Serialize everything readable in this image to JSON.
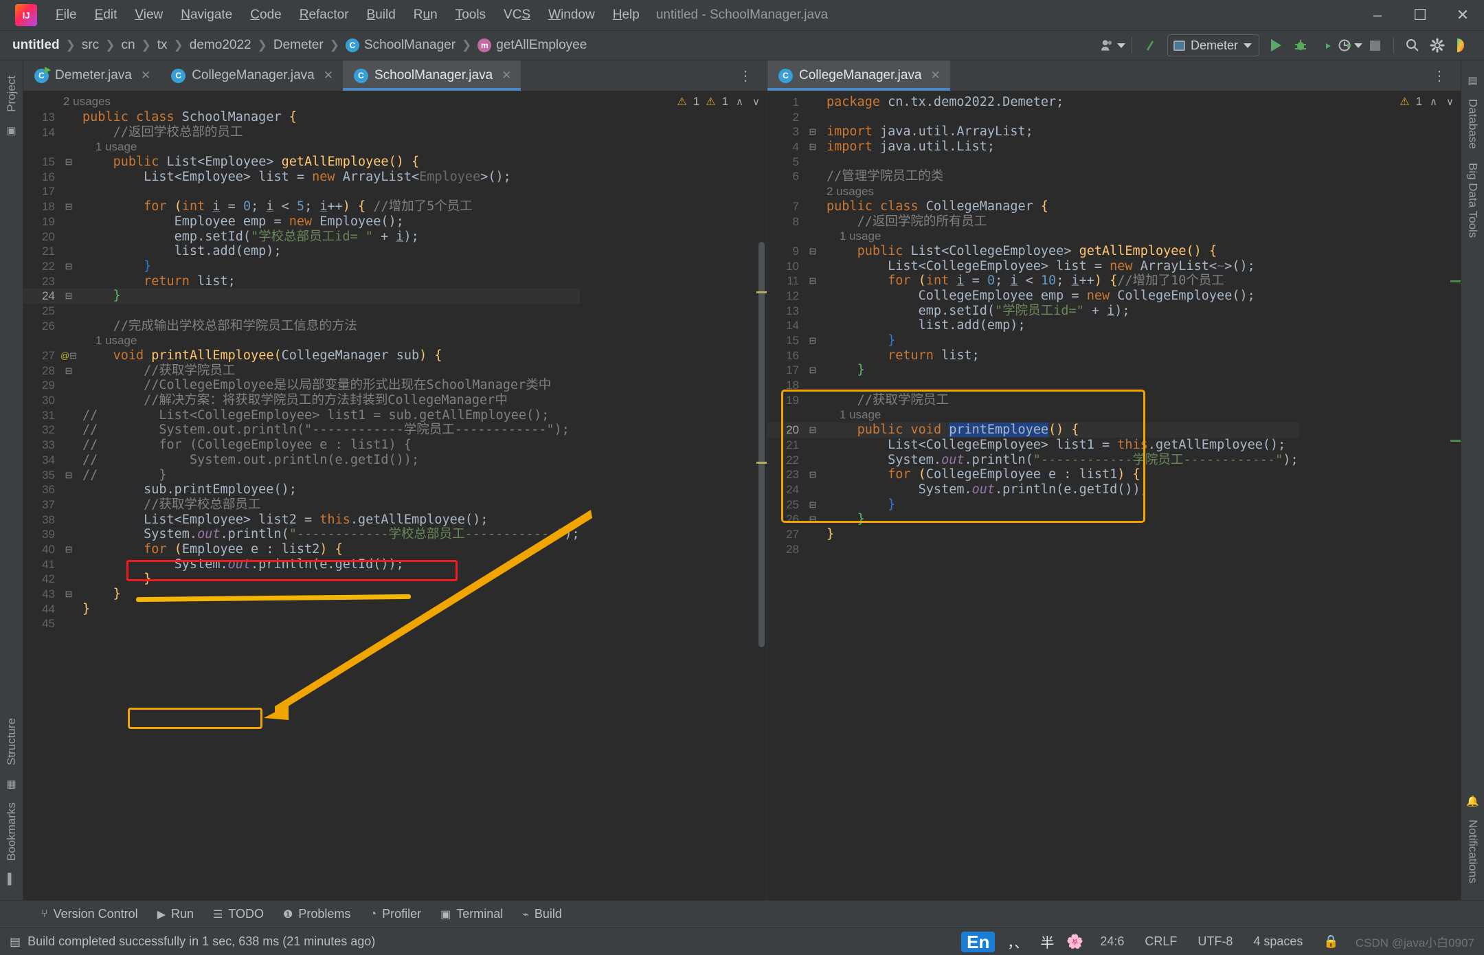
{
  "titlebar": {
    "logo": "intellij-idea-logo",
    "window_title": "untitled - SchoolManager.java",
    "menus": [
      {
        "pre": "",
        "mn": "F",
        "post": "ile"
      },
      {
        "pre": "",
        "mn": "E",
        "post": "dit"
      },
      {
        "pre": "",
        "mn": "V",
        "post": "iew"
      },
      {
        "pre": "",
        "mn": "N",
        "post": "avigate"
      },
      {
        "pre": "",
        "mn": "C",
        "post": "ode"
      },
      {
        "pre": "",
        "mn": "R",
        "post": "efactor"
      },
      {
        "pre": "",
        "mn": "B",
        "post": "uild"
      },
      {
        "pre": "R",
        "mn": "u",
        "post": "n"
      },
      {
        "pre": "",
        "mn": "T",
        "post": "ools"
      },
      {
        "pre": "VC",
        "mn": "S",
        "post": ""
      },
      {
        "pre": "",
        "mn": "W",
        "post": "indow"
      },
      {
        "pre": "",
        "mn": "H",
        "post": "elp"
      }
    ],
    "minimize": "–",
    "maximize": "☐",
    "close": "✕"
  },
  "navbar": {
    "crumbs": [
      {
        "label": "untitled",
        "icon": ""
      },
      {
        "label": "src",
        "icon": ""
      },
      {
        "label": "cn",
        "icon": ""
      },
      {
        "label": "tx",
        "icon": ""
      },
      {
        "label": "demo2022",
        "icon": ""
      },
      {
        "label": "Demeter",
        "icon": ""
      },
      {
        "label": "SchoolManager",
        "icon": "class-badge"
      },
      {
        "label": "getAllEmployee",
        "icon": "method-badge"
      }
    ],
    "separator": "❯",
    "class_badge_letter": "C",
    "method_badge_letter": "m",
    "run_config": "Demeter",
    "buttons": {
      "user": "user-icon",
      "updates": "update-project-icon",
      "run": "run-button",
      "debug": "debug-button",
      "coverage": "run-with-coverage-button",
      "profiler": "profiler-button",
      "stop": "stop-button",
      "search": "search-everywhere-button",
      "settings": "settings-button",
      "ai": "ai-assistant-button"
    }
  },
  "left_rail": {
    "project": "Project",
    "structure": "Structure",
    "bookmarks": "Bookmarks"
  },
  "right_rail": {
    "database": "Database",
    "bigdata": "Big Data Tools",
    "notifications": "Notifications"
  },
  "editor_left": {
    "tabs": [
      {
        "label": "Demeter.java",
        "active": false,
        "runnable": true
      },
      {
        "label": "CollegeManager.java",
        "active": false,
        "runnable": false
      },
      {
        "label": "SchoolManager.java",
        "active": true,
        "runnable": false
      }
    ],
    "overflow": "⋮",
    "inspection": {
      "warn1": "1",
      "warn2": "1",
      "up": "∧",
      "down": "∨"
    },
    "first_hint": "2 usages",
    "lines": [
      {
        "num": "13",
        "fold": "",
        "hint": "",
        "html": "<span class=\"kw\">public class </span><span class=\"cls\">SchoolManager </span><span class=\"brc-y\">{</span>"
      },
      {
        "num": "14",
        "fold": "",
        "hint": "",
        "html": "    <span class=\"cmt\">//返回学校总部的员工</span>"
      },
      {
        "num": "",
        "fold": "",
        "hint": "    1 usage",
        "html": ""
      },
      {
        "num": "15",
        "fold": "⊟",
        "hint": "",
        "html": "    <span class=\"kw\">public </span>List&lt;<span class=\"gen\">Employee</span>&gt; <span class=\"fn\">getAllEmployee</span><span class=\"brc-y\">() {</span>"
      },
      {
        "num": "16",
        "fold": "",
        "hint": "",
        "html": "        List&lt;<span class=\"gen\">Employee</span>&gt; list = <span class=\"kw\">new </span>ArrayList&lt;<span class=\"diamond\">Employee</span>&gt;();"
      },
      {
        "num": "17",
        "fold": "",
        "hint": "",
        "html": ""
      },
      {
        "num": "18",
        "fold": "⊟",
        "hint": "",
        "html": "        <span class=\"kw\">for </span><span class=\"brc-y\">(</span><span class=\"kw\">int </span><span class=\"var-u\">i</span> = <span class=\"num\">0</span>; <span class=\"var-u\">i</span> &lt; <span class=\"num\">5</span>; <span class=\"var-u\">i</span>++<span class=\"brc-y\">) {</span> <span class=\"cmt\">//增加了5个员工</span>"
      },
      {
        "num": "19",
        "fold": "",
        "hint": "",
        "html": "            Employee emp = <span class=\"kw\">new </span>Employee();"
      },
      {
        "num": "20",
        "fold": "",
        "hint": "",
        "html": "            emp.setId(<span class=\"str\">\"学校总部员工id= \" </span>+ <span class=\"var-u\">i</span>);"
      },
      {
        "num": "21",
        "fold": "",
        "hint": "",
        "html": "            list.add(emp);"
      },
      {
        "num": "22",
        "fold": "⊟",
        "hint": "",
        "html": "        <span class=\"brc-b\">}</span>"
      },
      {
        "num": "23",
        "fold": "",
        "hint": "",
        "html": "        <span class=\"kw\">return </span>list;"
      },
      {
        "num": "24",
        "fold": "⊟",
        "hint": "",
        "html": "    <span class=\"brc-g\">}</span>",
        "current": true
      },
      {
        "num": "25",
        "fold": "",
        "hint": "",
        "html": ""
      },
      {
        "num": "26",
        "fold": "",
        "hint": "",
        "html": "    <span class=\"cmt\">//完成输出学校总部和学院员工信息的方法</span>"
      },
      {
        "num": "",
        "fold": "",
        "hint": "    1 usage",
        "html": ""
      },
      {
        "num": "27",
        "fold": "⊟",
        "hint": "",
        "gutter": "@",
        "html": "    <span class=\"kw\">void </span><span class=\"fn\">printAllEmployee</span><span class=\"brc-y\">(</span>CollegeManager sub<span class=\"brc-y\">) {</span>"
      },
      {
        "num": "28",
        "fold": "⊟",
        "hint": "",
        "html": "        <span class=\"cmt\">//获取学院员工</span>"
      },
      {
        "num": "29",
        "fold": "",
        "hint": "",
        "html": "        <span class=\"cmt\">//CollegeEmployee是以局部变量的形式出现在SchoolManager类中</span>"
      },
      {
        "num": "30",
        "fold": "",
        "hint": "",
        "html": "        <span class=\"cmt\">//解决方案：将获取学院员工的方法封装到CollegeManager中</span>"
      },
      {
        "num": "31",
        "fold": "",
        "hint": "",
        "prefix": "//",
        "html": "        <span class=\"cmt\">List&lt;CollegeEmployee&gt; list1 = sub.getAllEmployee();</span>"
      },
      {
        "num": "32",
        "fold": "",
        "hint": "",
        "prefix": "//",
        "html": "        <span class=\"cmt\">System.out.println(\"------------学院员工------------\");</span>"
      },
      {
        "num": "33",
        "fold": "",
        "hint": "",
        "prefix": "//",
        "html": "        <span class=\"cmt\">for (CollegeEmployee e : list1) {</span>"
      },
      {
        "num": "34",
        "fold": "",
        "hint": "",
        "prefix": "//",
        "html": "            <span class=\"cmt\">System.out.println(e.getId());</span>"
      },
      {
        "num": "35",
        "fold": "⊟",
        "hint": "",
        "prefix": "//",
        "html": "        <span class=\"cmt\">}</span>"
      },
      {
        "num": "36",
        "fold": "",
        "hint": "",
        "html": "        sub.printEmployee();"
      },
      {
        "num": "37",
        "fold": "",
        "hint": "",
        "html": "        <span class=\"cmt\">//获取学校总部员工</span>"
      },
      {
        "num": "38",
        "fold": "",
        "hint": "",
        "html": "        List&lt;<span class=\"gen\">Employee</span>&gt; list2 = <span class=\"kw\">this</span>.getAllEmployee();"
      },
      {
        "num": "39",
        "fold": "",
        "hint": "",
        "html": "        System.<span class=\"fld\">out</span>.println(<span class=\"str\">\"------------学校总部员工------------\"</span>);"
      },
      {
        "num": "40",
        "fold": "⊟",
        "hint": "",
        "html": "        <span class=\"kw\">for </span><span class=\"brc-y\">(</span>Employee e : list2<span class=\"brc-y\">) {</span>"
      },
      {
        "num": "41",
        "fold": "",
        "hint": "",
        "html": "            System.<span class=\"fld\">out</span>.println(e.getId());"
      },
      {
        "num": "42",
        "fold": "",
        "hint": "",
        "html": "        <span class=\"brc-y\">}</span>"
      },
      {
        "num": "43",
        "fold": "⊟",
        "hint": "",
        "html": "    <span class=\"brc-y\">}</span>"
      },
      {
        "num": "44",
        "fold": "",
        "hint": "",
        "html": "<span class=\"brc-y\">}</span>"
      },
      {
        "num": "45",
        "fold": "",
        "hint": "",
        "html": ""
      }
    ]
  },
  "editor_right": {
    "tabs": [
      {
        "label": "CollegeManager.java",
        "active": true,
        "runnable": false
      }
    ],
    "overflow": "⋮",
    "inspection": {
      "warn1": "1",
      "up": "∧",
      "down": "∨"
    },
    "lines": [
      {
        "num": "1",
        "fold": "",
        "hint": "",
        "html": "<span class=\"kw\">package </span>cn.tx.demo2022.Demeter;"
      },
      {
        "num": "2",
        "fold": "",
        "hint": "",
        "html": ""
      },
      {
        "num": "3",
        "fold": "⊟",
        "hint": "",
        "html": "<span class=\"kw\">import </span>java.util.ArrayList;"
      },
      {
        "num": "4",
        "fold": "⊟",
        "hint": "",
        "html": "<span class=\"kw\">import </span>java.util.List;"
      },
      {
        "num": "5",
        "fold": "",
        "hint": "",
        "html": ""
      },
      {
        "num": "6",
        "fold": "",
        "hint": "",
        "html": "<span class=\"cmt\">//管理学院员工的类</span>"
      },
      {
        "num": "",
        "fold": "",
        "hint": "2 usages",
        "html": ""
      },
      {
        "num": "7",
        "fold": "",
        "hint": "",
        "html": "<span class=\"kw\">public class </span><span class=\"cls\">CollegeManager </span><span class=\"brc-y\">{</span>"
      },
      {
        "num": "8",
        "fold": "",
        "hint": "",
        "html": "    <span class=\"cmt\">//返回学院的所有员工</span>"
      },
      {
        "num": "",
        "fold": "",
        "hint": "    1 usage",
        "html": ""
      },
      {
        "num": "9",
        "fold": "⊟",
        "hint": "",
        "html": "    <span class=\"kw\">public </span>List&lt;<span class=\"gen\">CollegeEmployee</span>&gt; <span class=\"fn\">getAllEmployee</span><span class=\"brc-y\">() {</span>"
      },
      {
        "num": "10",
        "fold": "",
        "hint": "",
        "html": "        List&lt;<span class=\"gen\">CollegeEmployee</span>&gt; list = <span class=\"kw\">new </span>ArrayList&lt;<span class=\"diamond\">~</span>&gt;();"
      },
      {
        "num": "11",
        "fold": "⊟",
        "hint": "",
        "html": "        <span class=\"kw\">for </span><span class=\"brc-y\">(</span><span class=\"kw\">int </span><span class=\"var-u\">i</span> = <span class=\"num\">0</span>; <span class=\"var-u\">i</span> &lt; <span class=\"num\">10</span>; <span class=\"var-u\">i</span>++<span class=\"brc-y\">) {</span><span class=\"cmt\">//增加了10个员工</span>"
      },
      {
        "num": "12",
        "fold": "",
        "hint": "",
        "html": "            CollegeEmployee emp = <span class=\"kw\">new </span>CollegeEmployee();"
      },
      {
        "num": "13",
        "fold": "",
        "hint": "",
        "html": "            emp.setId(<span class=\"str\">\"学院员工id=\" </span>+ <span class=\"var-u\">i</span>);"
      },
      {
        "num": "14",
        "fold": "",
        "hint": "",
        "html": "            list.add(emp);"
      },
      {
        "num": "15",
        "fold": "⊟",
        "hint": "",
        "html": "        <span class=\"brc-b\">}</span>"
      },
      {
        "num": "16",
        "fold": "",
        "hint": "",
        "html": "        <span class=\"kw\">return </span>list;"
      },
      {
        "num": "17",
        "fold": "⊟",
        "hint": "",
        "html": "    <span class=\"brc-g\">}</span>"
      },
      {
        "num": "18",
        "fold": "",
        "hint": "",
        "html": ""
      },
      {
        "num": "19",
        "fold": "",
        "hint": "",
        "html": "    <span class=\"cmt\">//获取学院员工</span>"
      },
      {
        "num": "",
        "fold": "",
        "hint": "    1 usage",
        "html": ""
      },
      {
        "num": "20",
        "fold": "⊟",
        "hint": "",
        "html": "    <span class=\"kw\">public void </span><span class=\"sel\">printEmployee</span><span class=\"brc-y\">() {</span>",
        "current": true
      },
      {
        "num": "21",
        "fold": "",
        "hint": "",
        "html": "        List&lt;<span class=\"gen\">CollegeEmployee</span>&gt; list1 = <span class=\"kw\">this</span>.getAllEmployee();"
      },
      {
        "num": "22",
        "fold": "",
        "hint": "",
        "html": "        System.<span class=\"fld\">out</span>.println(<span class=\"str\">\"------------学院员工------------\"</span>);"
      },
      {
        "num": "23",
        "fold": "⊟",
        "hint": "",
        "html": "        <span class=\"kw\">for </span><span class=\"brc-y\">(</span>CollegeEmployee e : list1<span class=\"brc-y\">) {</span>"
      },
      {
        "num": "24",
        "fold": "",
        "hint": "",
        "html": "            System.<span class=\"fld\">out</span>.println(e.getId());"
      },
      {
        "num": "25",
        "fold": "⊟",
        "hint": "",
        "html": "        <span class=\"brc-b\">}</span>"
      },
      {
        "num": "26",
        "fold": "⊟",
        "hint": "",
        "html": "    <span class=\"brc-g\">}</span>"
      },
      {
        "num": "27",
        "fold": "",
        "hint": "",
        "html": "<span class=\"brc-y\">}</span>"
      },
      {
        "num": "28",
        "fold": "",
        "hint": "",
        "html": ""
      }
    ]
  },
  "annotations": {
    "red_box_text": "//CollegeEmployee是以局部变量的形式出现在SchoolManager类中",
    "yellow_underline_text": "//解决方案：将获取学院员工的方法封装到CollegeManager中",
    "yellow_box_call": "sub.printEmployee();",
    "arrow": "arrow-pointing-left",
    "colors": {
      "red": "#f21c1c",
      "yellow": "#f0a500",
      "accent_blue": "#4a88c7"
    }
  },
  "bottom_tools": [
    {
      "label": "Version Control",
      "icon": "branch-icon"
    },
    {
      "label": "Run",
      "icon": "play-icon"
    },
    {
      "label": "TODO",
      "icon": "list-icon"
    },
    {
      "label": "Problems",
      "icon": "error-icon"
    },
    {
      "label": "Profiler",
      "icon": "profiler-icon"
    },
    {
      "label": "Terminal",
      "icon": "terminal-icon"
    },
    {
      "label": "Build",
      "icon": "hammer-icon"
    }
  ],
  "statusbar": {
    "icon": "console-icon",
    "message": "Build completed successfully in 1 sec, 638 ms (21 minutes ago)",
    "ime": "En",
    "ime_extras": [
      "，、",
      "半",
      "ime-flower-icon"
    ],
    "caret": "24:6",
    "line_separator": "CRLF",
    "encoding": "UTF-8",
    "indent": "4 spaces",
    "lock": "lock-icon",
    "watermark": "CSDN @java小白0907"
  }
}
